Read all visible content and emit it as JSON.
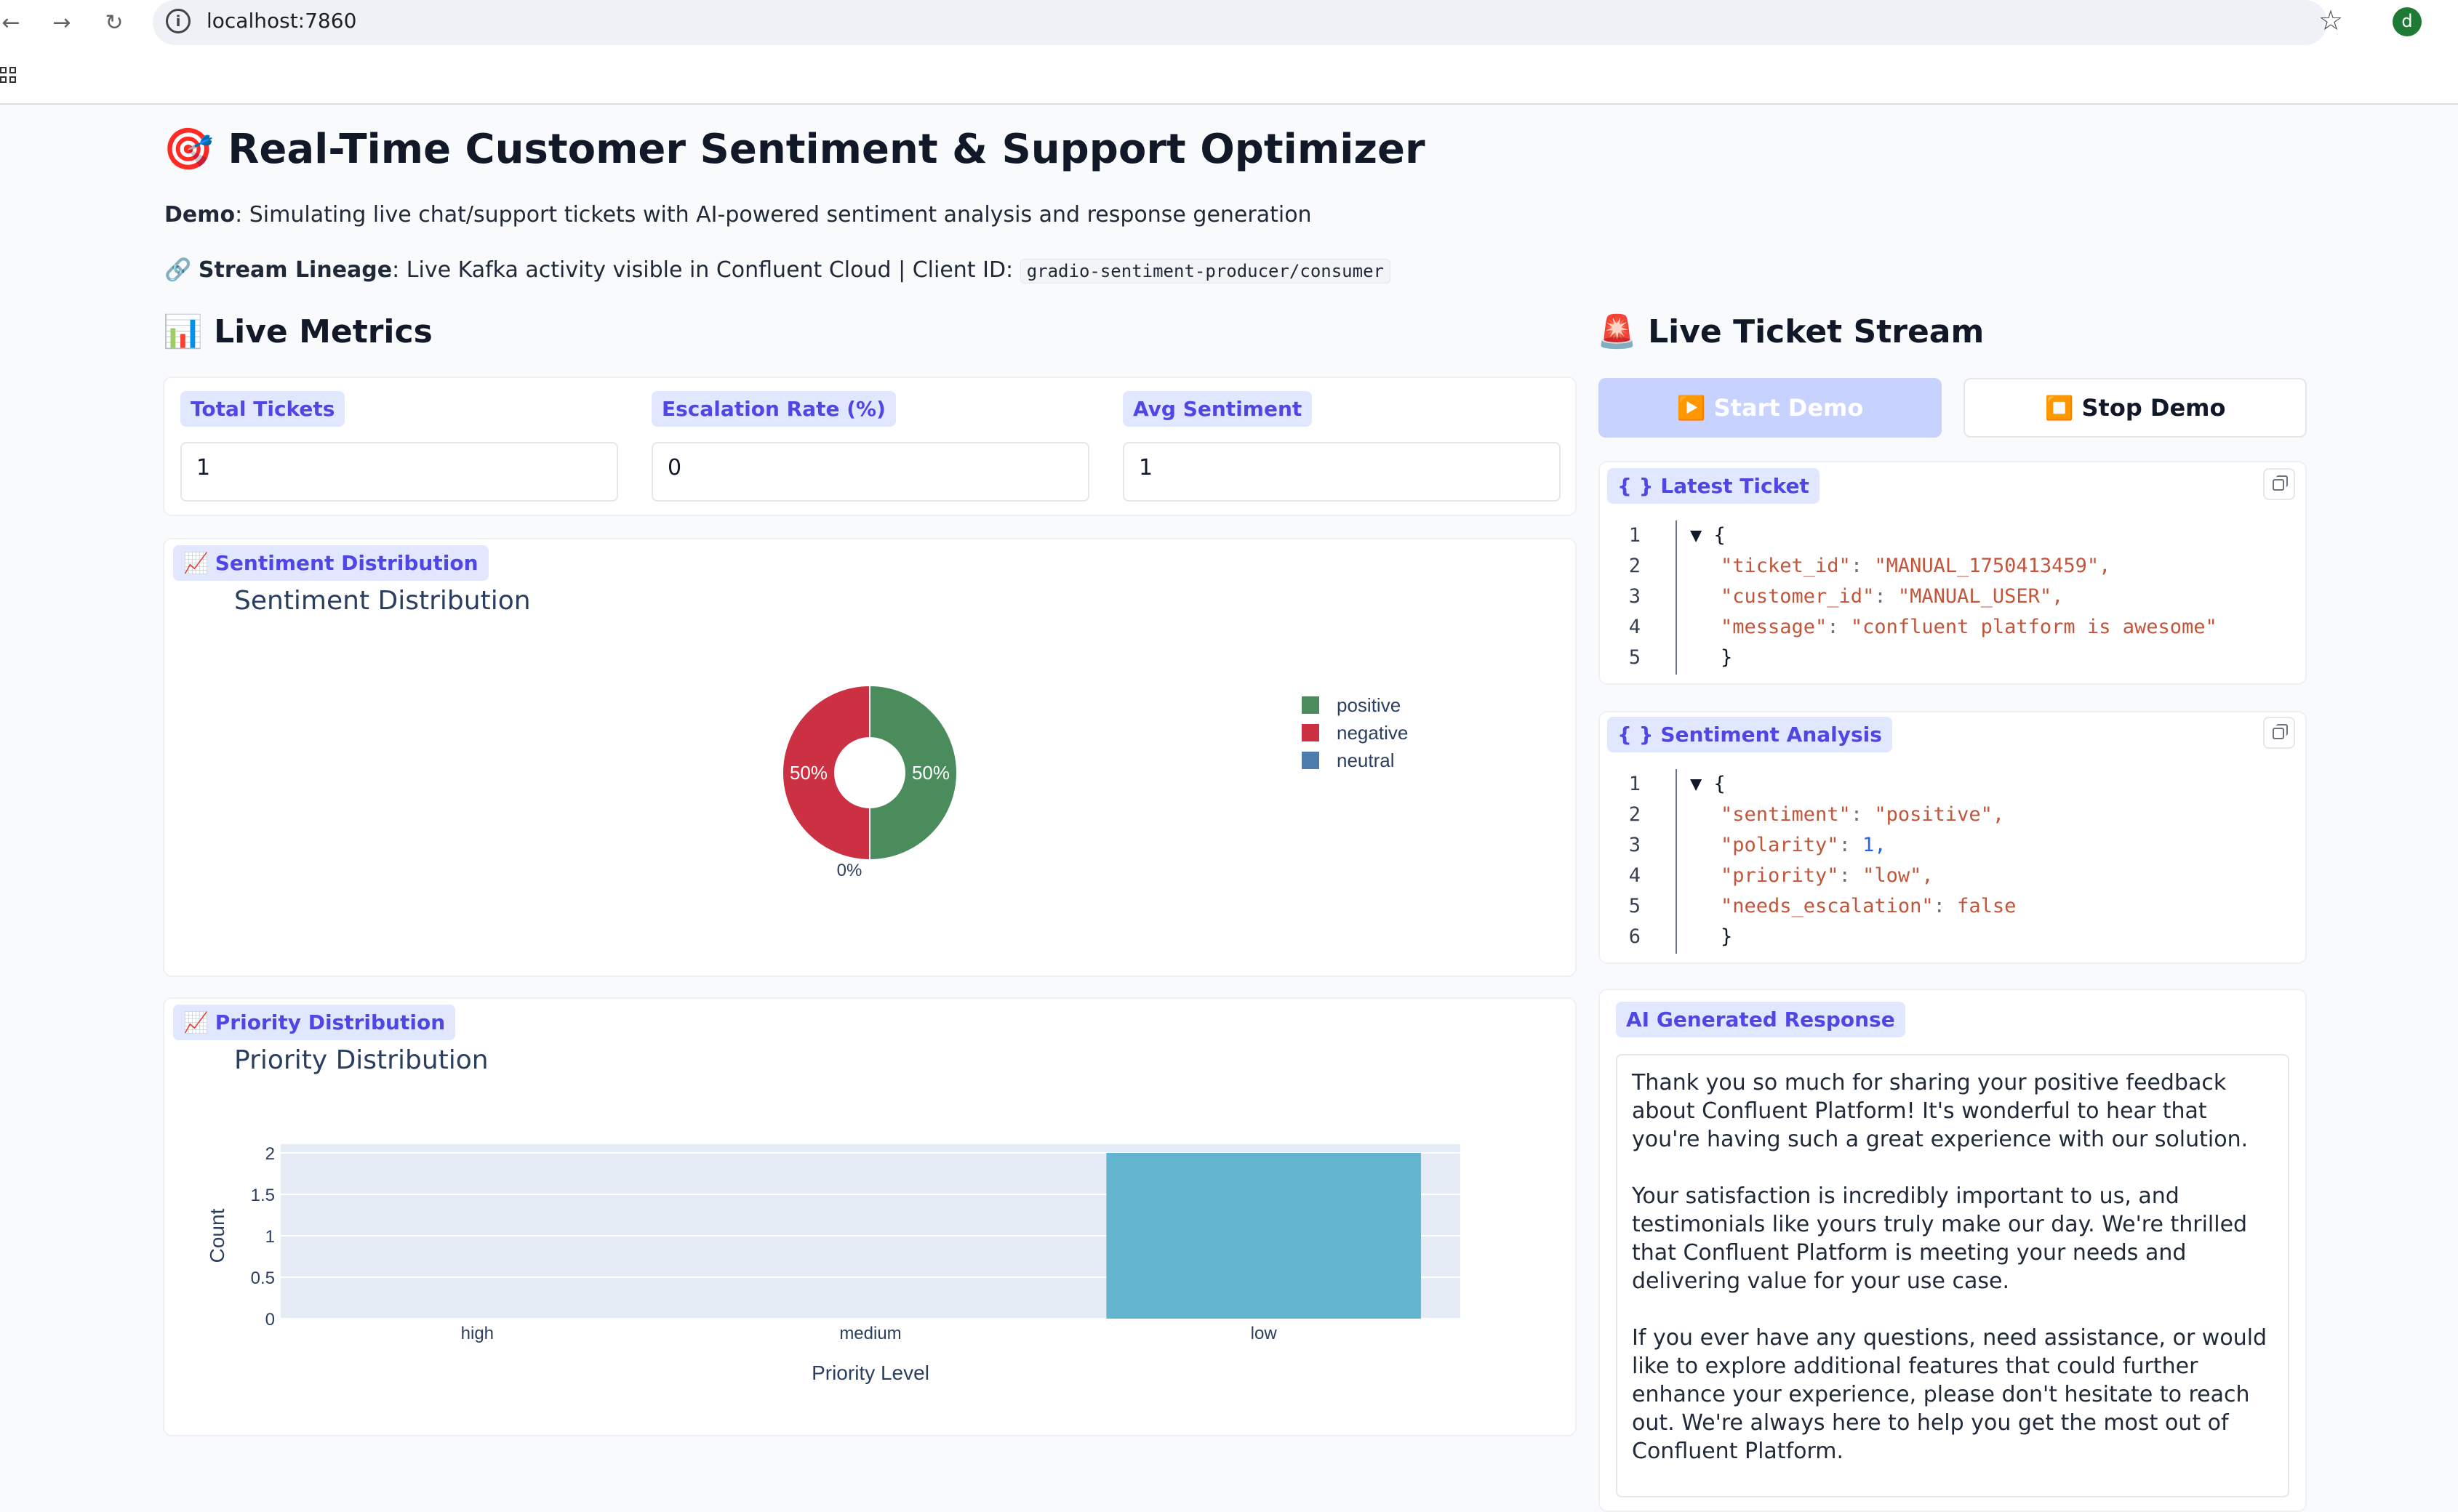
{
  "browser": {
    "url": "localhost:7860"
  },
  "page": {
    "title": "🎯 Real-Time Customer Sentiment & Support Optimizer",
    "demo_label": "Demo",
    "demo_text": ": Simulating live chat/support tickets with AI-powered sentiment analysis and response generation",
    "lineage_icon": "🔗",
    "lineage_label": "Stream Lineage",
    "lineage_text": ": Live Kafka activity visible in Confluent Cloud | Client ID: ",
    "client_id": "gradio-sentiment-producer/consumer"
  },
  "metrics": {
    "heading": "📊 Live Metrics",
    "items": [
      {
        "label": "Total Tickets",
        "value": "1"
      },
      {
        "label": "Escalation Rate (%)",
        "value": "0"
      },
      {
        "label": "Avg Sentiment",
        "value": "1"
      }
    ]
  },
  "sentiment_plot": {
    "chip_label": "Sentiment Distribution",
    "title": "Sentiment Distribution"
  },
  "priority_plot": {
    "chip_label": "Priority Distribution",
    "title": "Priority Distribution"
  },
  "chart_data": [
    {
      "type": "pie",
      "title": "Sentiment Distribution",
      "labels": [
        "positive",
        "negative",
        "neutral"
      ],
      "values": [
        50,
        50,
        0
      ],
      "value_labels": [
        "50%",
        "50%",
        "0%"
      ],
      "colors": [
        "#4a8c5c",
        "#cb3142",
        "#4c7cad"
      ],
      "hole": true,
      "legend_position": "right"
    },
    {
      "type": "bar",
      "title": "Priority Distribution",
      "categories": [
        "high",
        "medium",
        "low"
      ],
      "values": [
        0,
        0,
        2
      ],
      "xlabel": "Priority Level",
      "ylabel": "Count",
      "ylim": [
        0,
        2
      ],
      "yticks": [
        "0",
        "0.5",
        "1",
        "1.5",
        "2"
      ],
      "bar_color": "#62b4cf",
      "plot_bg": "#e5ecf6"
    }
  ],
  "stream": {
    "heading": "🚨 Live Ticket Stream",
    "start_label": "▶️ Start Demo",
    "stop_label": "⏹️ Stop Demo"
  },
  "latest_ticket": {
    "chip_label": "{ } Latest Ticket",
    "lines": [
      {
        "n": "1",
        "k": "",
        "v": "▼ {"
      },
      {
        "n": "2",
        "k": "\"ticket_id\"",
        "v": "\"MANUAL_1750413459\","
      },
      {
        "n": "3",
        "k": "\"customer_id\"",
        "v": "\"MANUAL_USER\","
      },
      {
        "n": "4",
        "k": "\"message\"",
        "v": "\"confluent platform is awesome\""
      },
      {
        "n": "5",
        "k": "",
        "v": "}"
      }
    ]
  },
  "sentiment_analysis": {
    "chip_label": "{ } Sentiment Analysis",
    "lines": [
      {
        "n": "1",
        "k": "",
        "v": "▼ {"
      },
      {
        "n": "2",
        "k": "\"sentiment\"",
        "v": "\"positive\","
      },
      {
        "n": "3",
        "k": "\"polarity\"",
        "v": "1,"
      },
      {
        "n": "4",
        "k": "\"priority\"",
        "v": "\"low\","
      },
      {
        "n": "5",
        "k": "\"needs_escalation\"",
        "v": "false"
      },
      {
        "n": "6",
        "k": "",
        "v": "}"
      }
    ]
  },
  "ai_response": {
    "chip_label": "AI Generated Response",
    "text": "Thank you so much for sharing your positive feedback about Confluent Platform! It's wonderful to hear that you're having such a great experience with our solution.\n\nYour satisfaction is incredibly important to us, and testimonials like yours truly make our day. We're thrilled that Confluent Platform is meeting your needs and delivering value for your use case.\n\nIf you ever have any questions, need assistance, or would like to explore additional features that could further enhance your experience, please don't hesitate to reach out. We're always here to help you get the most out of Confluent Platform.\n\nThank you again for taking the time to share your feedback -"
  }
}
